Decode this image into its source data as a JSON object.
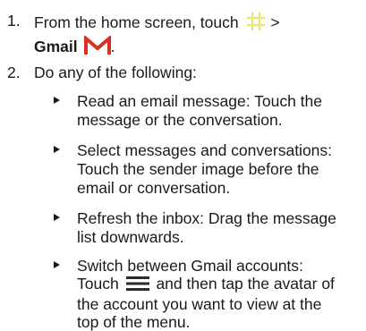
{
  "steps": [
    {
      "number": "1.",
      "text_before": "From the home screen, touch",
      "apps_icon": "apps-grid-icon",
      "separator": " >",
      "app_name": "Gmail",
      "gmail_icon": "gmail-icon",
      "period": "."
    },
    {
      "number": "2.",
      "text": "Do any of the following:"
    }
  ],
  "bullets": [
    {
      "line1": "Read an email message: Touch the",
      "line2": "message or the conversation."
    },
    {
      "line1": "Select messages and conversations:",
      "line2": "Touch the sender image before the",
      "line3": "email or conversation."
    },
    {
      "line1": "Refresh the inbox: Drag the message",
      "line2": "list downwards."
    },
    {
      "line1": "Switch between Gmail accounts:",
      "line2_before": "Touch",
      "menu_icon": "menu-icon",
      "line2_after": "and then tap the avatar of",
      "line3": "the account you want to view at the",
      "line4": "top of the menu."
    }
  ],
  "colors": {
    "text": "#1a1a1a",
    "apps_icon": "#e8eb6a",
    "gmail_red": "#d93025",
    "menu_icon": "#2b2b2b"
  }
}
